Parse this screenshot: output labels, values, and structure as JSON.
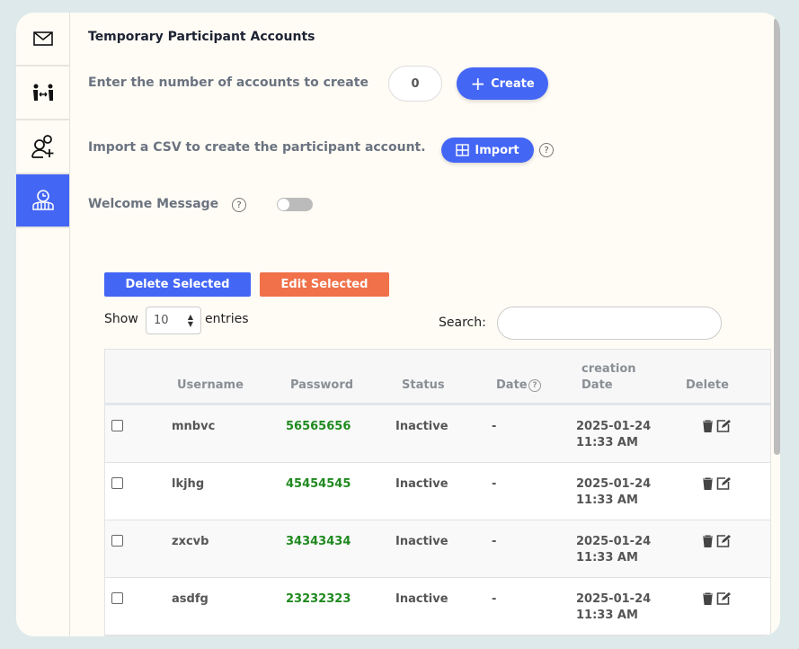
{
  "sidebar": {
    "items": [
      {
        "icon": "mail-icon"
      },
      {
        "icon": "participants-swap-icon"
      },
      {
        "icon": "add-user-icon"
      },
      {
        "icon": "temporary-account-icon",
        "active": true
      }
    ]
  },
  "title": "Temporary Participant Accounts",
  "create": {
    "label": "Enter the number of accounts to create",
    "value": "0",
    "button": "Create"
  },
  "import": {
    "label": "Import a CSV to create the participant account.",
    "button": "Import"
  },
  "welcome": {
    "label": "Welcome Message",
    "enabled": false
  },
  "actions": {
    "delete_selected": "Delete Selected",
    "edit_selected": "Edit Selected"
  },
  "colors": {
    "primary": "#4466f5",
    "edit": "#f0714a",
    "password": "#1f8a1f"
  },
  "length": {
    "show": "Show",
    "value": "10",
    "entries": "entries"
  },
  "search": {
    "label": "Search:",
    "value": ""
  },
  "table": {
    "headers": {
      "username": "Username",
      "password": "Password",
      "status": "Status",
      "date": "Date",
      "creation1": "creation",
      "creation2": "Date",
      "delete": "Delete"
    },
    "rows": [
      {
        "username": "mnbvc",
        "password": "56565656",
        "status": "Inactive",
        "date": "-",
        "created_date": "2025-01-24",
        "created_time": "11:33 AM"
      },
      {
        "username": "lkjhg",
        "password": "45454545",
        "status": "Inactive",
        "date": "-",
        "created_date": "2025-01-24",
        "created_time": "11:33 AM"
      },
      {
        "username": "zxcvb",
        "password": "34343434",
        "status": "Inactive",
        "date": "-",
        "created_date": "2025-01-24",
        "created_time": "11:33 AM"
      },
      {
        "username": "asdfg",
        "password": "23232323",
        "status": "Inactive",
        "date": "-",
        "created_date": "2025-01-24",
        "created_time": "11:33 AM"
      }
    ]
  }
}
